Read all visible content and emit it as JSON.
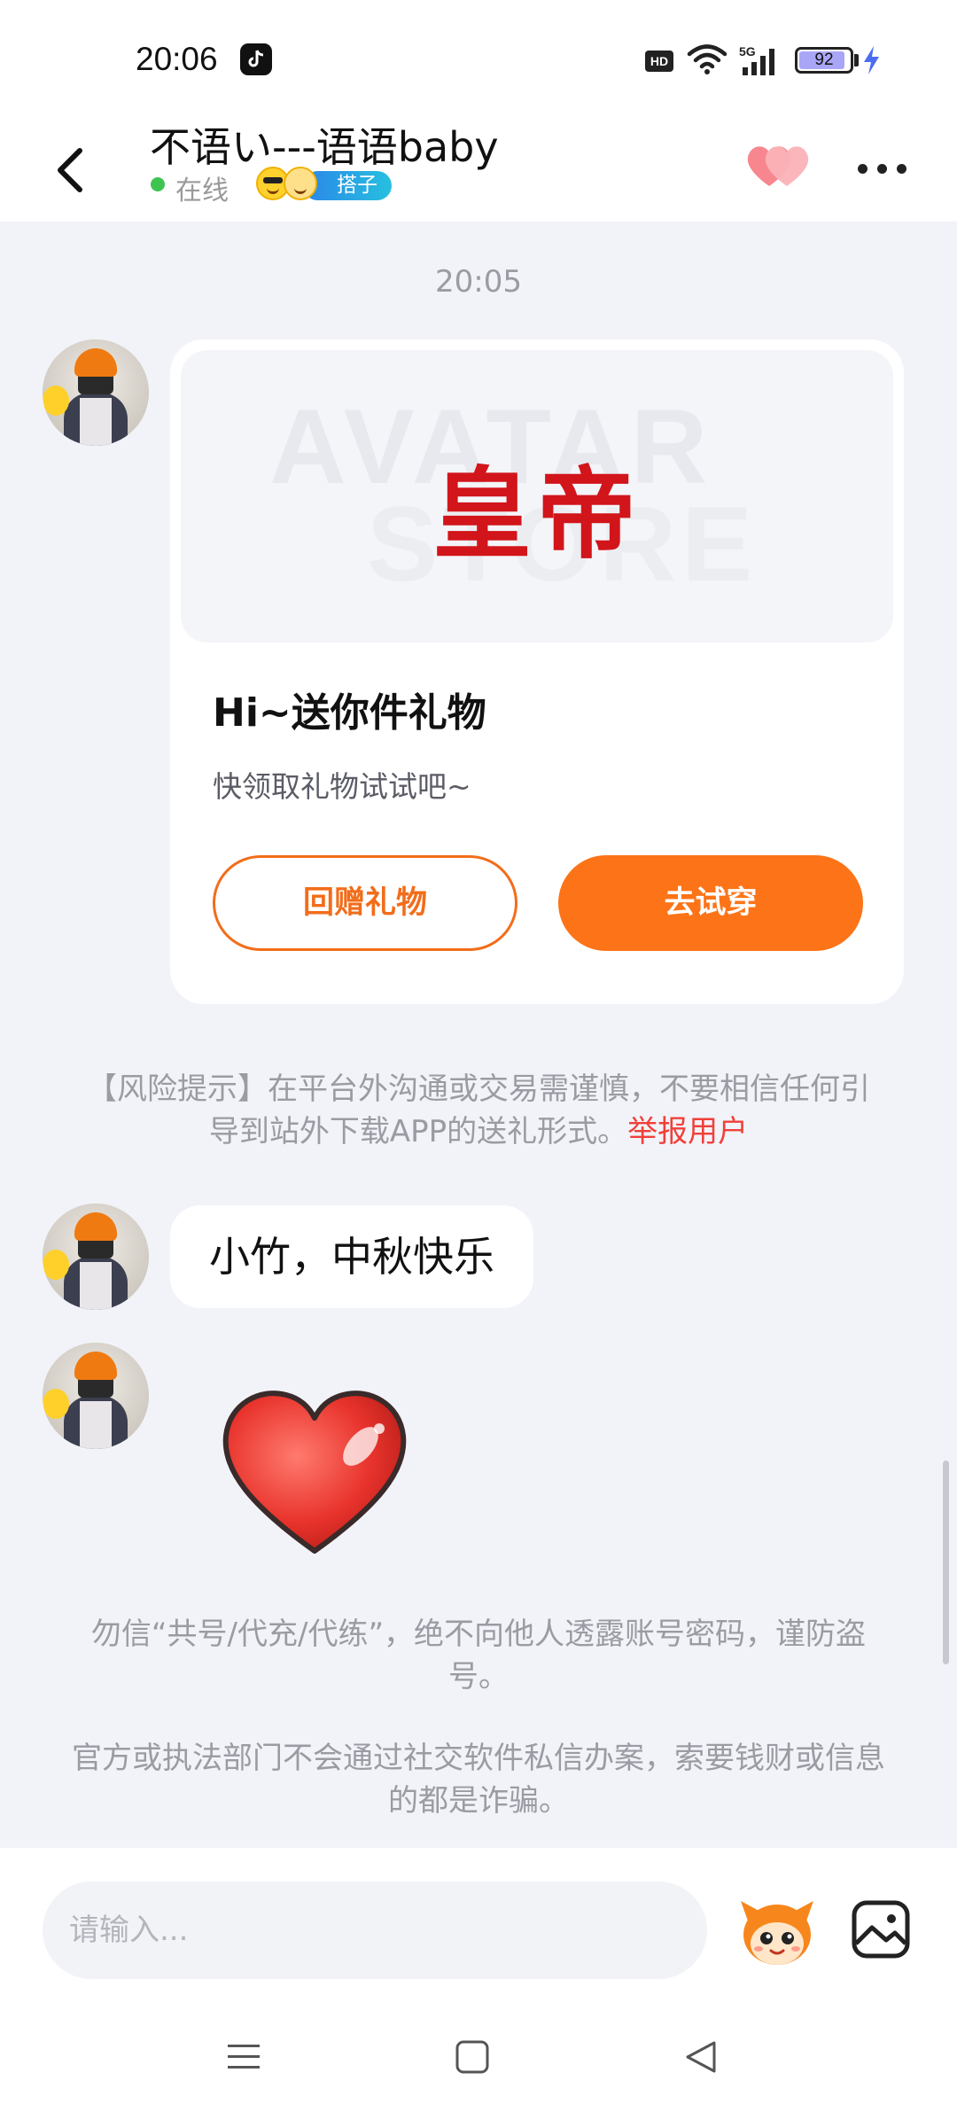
{
  "status_bar": {
    "time": "20:06",
    "hd_label": "HD",
    "network_label": "5G",
    "battery_level": "92",
    "battery_fraction": 0.92,
    "icons": [
      "tiktok-icon",
      "wifi-icon",
      "signal-icon",
      "battery-icon",
      "charging-bolt-icon"
    ]
  },
  "header": {
    "title": "不语い---语语baby",
    "status": "在线",
    "relation_tag": "搭子",
    "icons": [
      "back-arrow-icon",
      "emoji-icon",
      "hearts-icon",
      "more-icon"
    ]
  },
  "chat": {
    "timestamp": "20:05",
    "gift_card": {
      "banner_watermark_1": "AVATAR",
      "banner_watermark_2": "STORE",
      "item_name": "皇帝",
      "title": "Hi~送你件礼物",
      "subtitle": "快领取礼物试试吧~",
      "return_gift_label": "回赠礼物",
      "try_on_label": "去试穿"
    },
    "risk_notice": {
      "text": "【风险提示】在平台外沟通或交易需谨慎，不要相信任何引导到站外下载APP的送礼形式。",
      "report_link": "举报用户"
    },
    "messages": [
      {
        "type": "text",
        "text": "小竹，中秋快乐"
      },
      {
        "type": "sticker",
        "sticker": "red-heart"
      }
    ],
    "safety_notices": [
      "勿信“共号/代充/代练”，绝不向他人透露账号密码，谨防盗号。",
      "官方或执法部门不会通过社交软件私信办案，索要钱财或信息的都是诈骗。"
    ]
  },
  "input_bar": {
    "placeholder": "请输入...",
    "icons": [
      "mascot-icon",
      "image-icon"
    ]
  },
  "colors": {
    "accent_orange": "#fc7417",
    "report_red": "#f0403a",
    "online_green": "#3dc451",
    "chat_background": "#f2f3f8"
  }
}
